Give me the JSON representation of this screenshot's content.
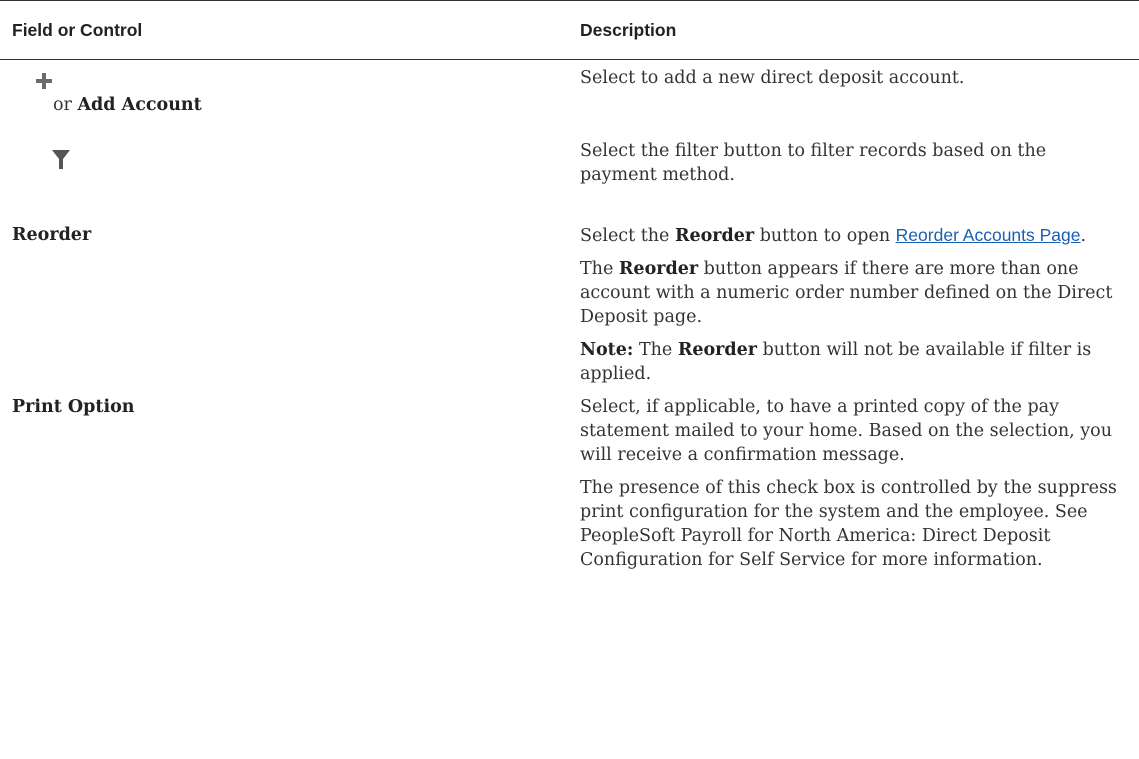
{
  "table": {
    "header": {
      "field": "Field or Control",
      "description": "Description"
    },
    "rows": [
      {
        "field_icon": "plus-icon",
        "field_prefix": "or",
        "field_label": "Add Account",
        "paragraphs": [
          {
            "text": "Select to add a new direct deposit account."
          }
        ]
      },
      {
        "field_icon": "filter-icon",
        "paragraphs": [
          {
            "text": "Select the filter button to filter records based on the payment method."
          }
        ]
      },
      {
        "field_label": "Reorder",
        "p1_pre": "Select the",
        "p1_bold": "Reorder",
        "p1_mid": "button to open",
        "p1_link": "Reorder Accounts Page",
        "p1_end": ".",
        "p2_pre": "The",
        "p2_bold": "Reorder",
        "p2_post": "button appears if there are more than one account with a numeric order number defined on the Direct Deposit page.",
        "p3_note": "Note:",
        "p3_mid": "The",
        "p3_bold": "Reorder",
        "p3_post": "button will not be available if filter is applied."
      },
      {
        "field_label": "Print Option",
        "p1": "Select, if applicable, to have a printed copy of the pay statement mailed to your home. Based on the selection, you will receive a confirmation message.",
        "p2": "The presence of this check box is controlled by the suppress print configuration for the system and the employee. See PeopleSoft Payroll for North America: Direct Deposit Configuration for Self Service for more information."
      }
    ]
  },
  "colors": {
    "text": "#333333",
    "link": "#1a5fb4",
    "icon": "#6b6b6b"
  }
}
